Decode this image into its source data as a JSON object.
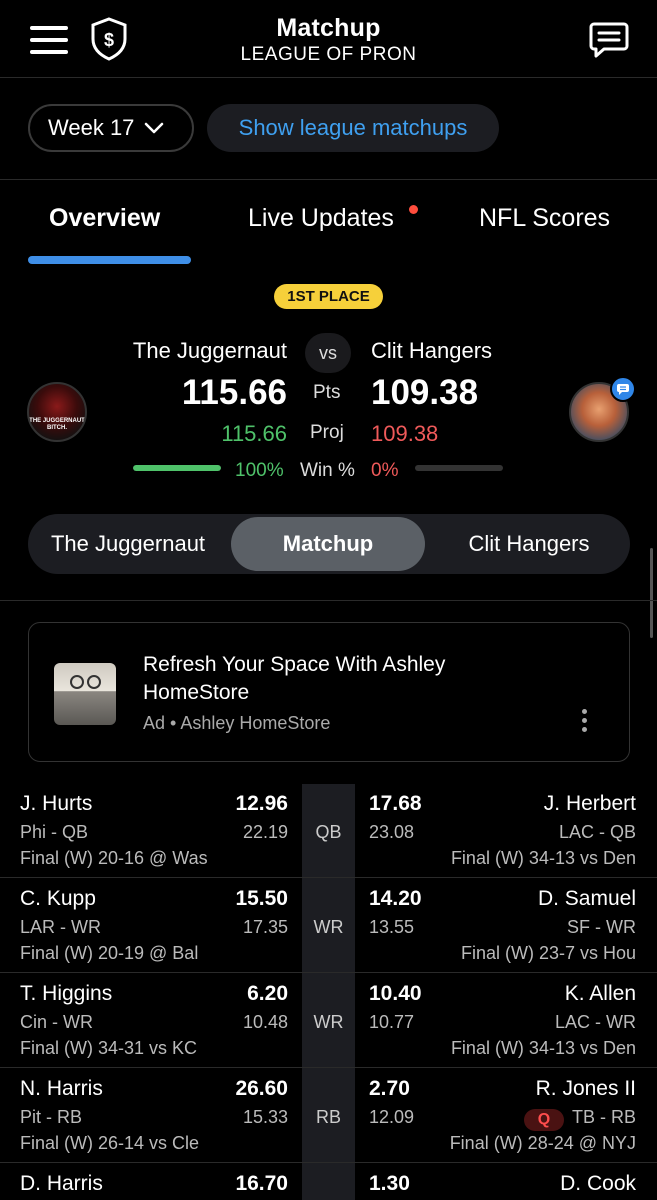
{
  "header": {
    "title": "Matchup",
    "league_name": "LEAGUE OF PRON"
  },
  "week_selector": {
    "label": "Week 17"
  },
  "league_matchups_button": "Show league matchups",
  "tabs": [
    {
      "label": "Overview",
      "active": true
    },
    {
      "label": "Live Updates",
      "has_notification_dot": true
    },
    {
      "label": "NFL Scores"
    }
  ],
  "matchup": {
    "badge": "1ST PLACE",
    "vs": "vs",
    "labels": {
      "pts": "Pts",
      "proj": "Proj",
      "win": "Win %"
    },
    "left_team": {
      "name": "The Juggernaut",
      "points": "115.66",
      "projected": "115.66",
      "win_pct": "100%",
      "win_fraction": 1.0,
      "avatar_text": "THE JUGGERNAUT BITCH."
    },
    "right_team": {
      "name": "Clit Hangers",
      "points": "109.38",
      "projected": "109.38",
      "win_pct": "0%",
      "win_fraction": 0.0
    }
  },
  "segment_control": {
    "items": [
      "The Juggernaut",
      "Matchup",
      "Clit Hangers"
    ],
    "active_index": 1
  },
  "ad": {
    "title": "Refresh Your Space With Ashley HomeStore",
    "subtitle": "Ad • Ashley HomeStore"
  },
  "roster": [
    {
      "pos": "QB",
      "left": {
        "name": "J. Hurts",
        "points": "12.96",
        "team_pos": "Phi - QB",
        "proj": "22.19",
        "game": "Final (W) 20-16 @ Was"
      },
      "right": {
        "name": "J. Herbert",
        "points": "17.68",
        "team_pos": "LAC - QB",
        "proj": "23.08",
        "game": "Final (W) 34-13 vs Den"
      }
    },
    {
      "pos": "WR",
      "left": {
        "name": "C. Kupp",
        "points": "15.50",
        "team_pos": "LAR - WR",
        "proj": "17.35",
        "game": "Final (W) 20-19 @ Bal"
      },
      "right": {
        "name": "D. Samuel",
        "points": "14.20",
        "team_pos": "SF - WR",
        "proj": "13.55",
        "game": "Final (W) 23-7 vs Hou"
      }
    },
    {
      "pos": "WR",
      "left": {
        "name": "T. Higgins",
        "points": "6.20",
        "team_pos": "Cin - WR",
        "proj": "10.48",
        "game": "Final (W) 34-31 vs KC"
      },
      "right": {
        "name": "K. Allen",
        "points": "10.40",
        "team_pos": "LAC - WR",
        "proj": "10.77",
        "game": "Final (W) 34-13 vs Den"
      }
    },
    {
      "pos": "RB",
      "left": {
        "name": "N. Harris",
        "points": "26.60",
        "team_pos": "Pit - RB",
        "proj": "15.33",
        "game": "Final (W) 26-14 vs Cle"
      },
      "right": {
        "name": "R. Jones II",
        "points": "2.70",
        "team_pos": "TB - RB",
        "proj": "12.09",
        "game": "Final (W) 28-24 @ NYJ",
        "status_badge": "Q"
      }
    },
    {
      "pos": "RB",
      "left": {
        "name": "D. Harris",
        "points": "16.70",
        "team_pos": "",
        "proj": "",
        "game": ""
      },
      "right": {
        "name": "D. Cook",
        "points": "1.30",
        "team_pos": "",
        "proj": "",
        "game": ""
      }
    }
  ],
  "colors": {
    "background": "#000000",
    "accent_blue": "#3f8fe8",
    "link_blue": "#3fa0f0",
    "positive_green": "#4fc26a",
    "negative_red": "#ef5a5a",
    "badge_yellow": "#f6d03a",
    "panel": "#1c1d22"
  }
}
